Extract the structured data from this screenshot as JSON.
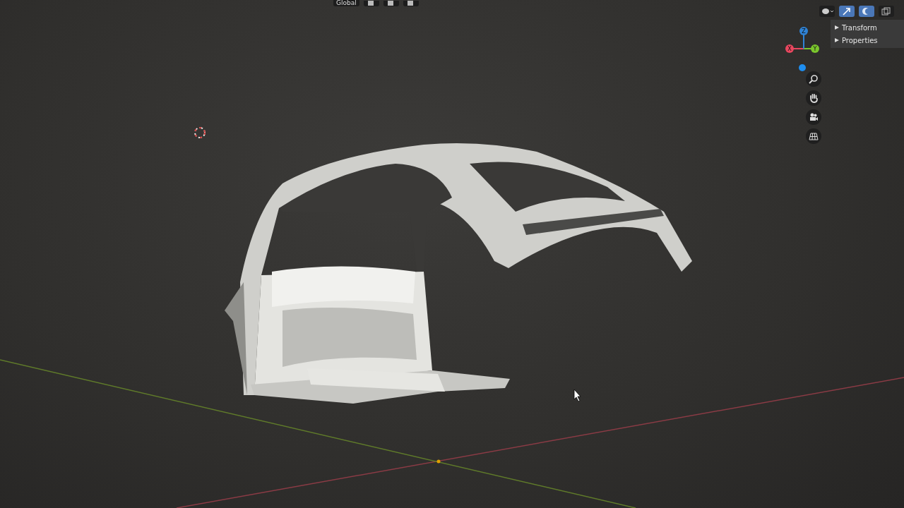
{
  "header": {
    "orientation": "Global"
  },
  "sidebar": {
    "panels": [
      {
        "label": "Transform",
        "expanded": false
      },
      {
        "label": "Properties",
        "expanded": false
      }
    ]
  },
  "gizmo": {
    "axes": [
      {
        "label": "X",
        "color": "#e8475f"
      },
      {
        "label": "Y",
        "color": "#7bc62d"
      },
      {
        "label": "Z",
        "color": "#2f83d6"
      }
    ]
  }
}
